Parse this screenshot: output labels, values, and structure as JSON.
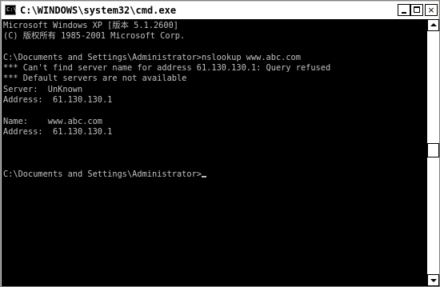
{
  "window": {
    "title": "C:\\WINDOWS\\system32\\cmd.exe",
    "icon_label": "C:\\",
    "icon": "console-icon",
    "controls": {
      "minimize_icon": "minimize-icon",
      "maximize_icon": "maximize-icon",
      "close_glyph": "×"
    }
  },
  "console": {
    "text_color": "#c0c0c0",
    "background_color": "#000000",
    "lines": [
      "Microsoft Windows XP [版本 5.1.2600]",
      "(C) 版权所有 1985-2001 Microsoft Corp.",
      "",
      "C:\\Documents and Settings\\Administrator>nslookup www.abc.com",
      "*** Can't find server name for address 61.130.130.1: Query refused",
      "*** Default servers are not available",
      "Server:  UnKnown",
      "Address:  61.130.130.1",
      "",
      "Name:    www.abc.com",
      "Address:  61.130.130.1",
      "",
      "",
      "",
      "C:\\Documents and Settings\\Administrator>"
    ]
  }
}
